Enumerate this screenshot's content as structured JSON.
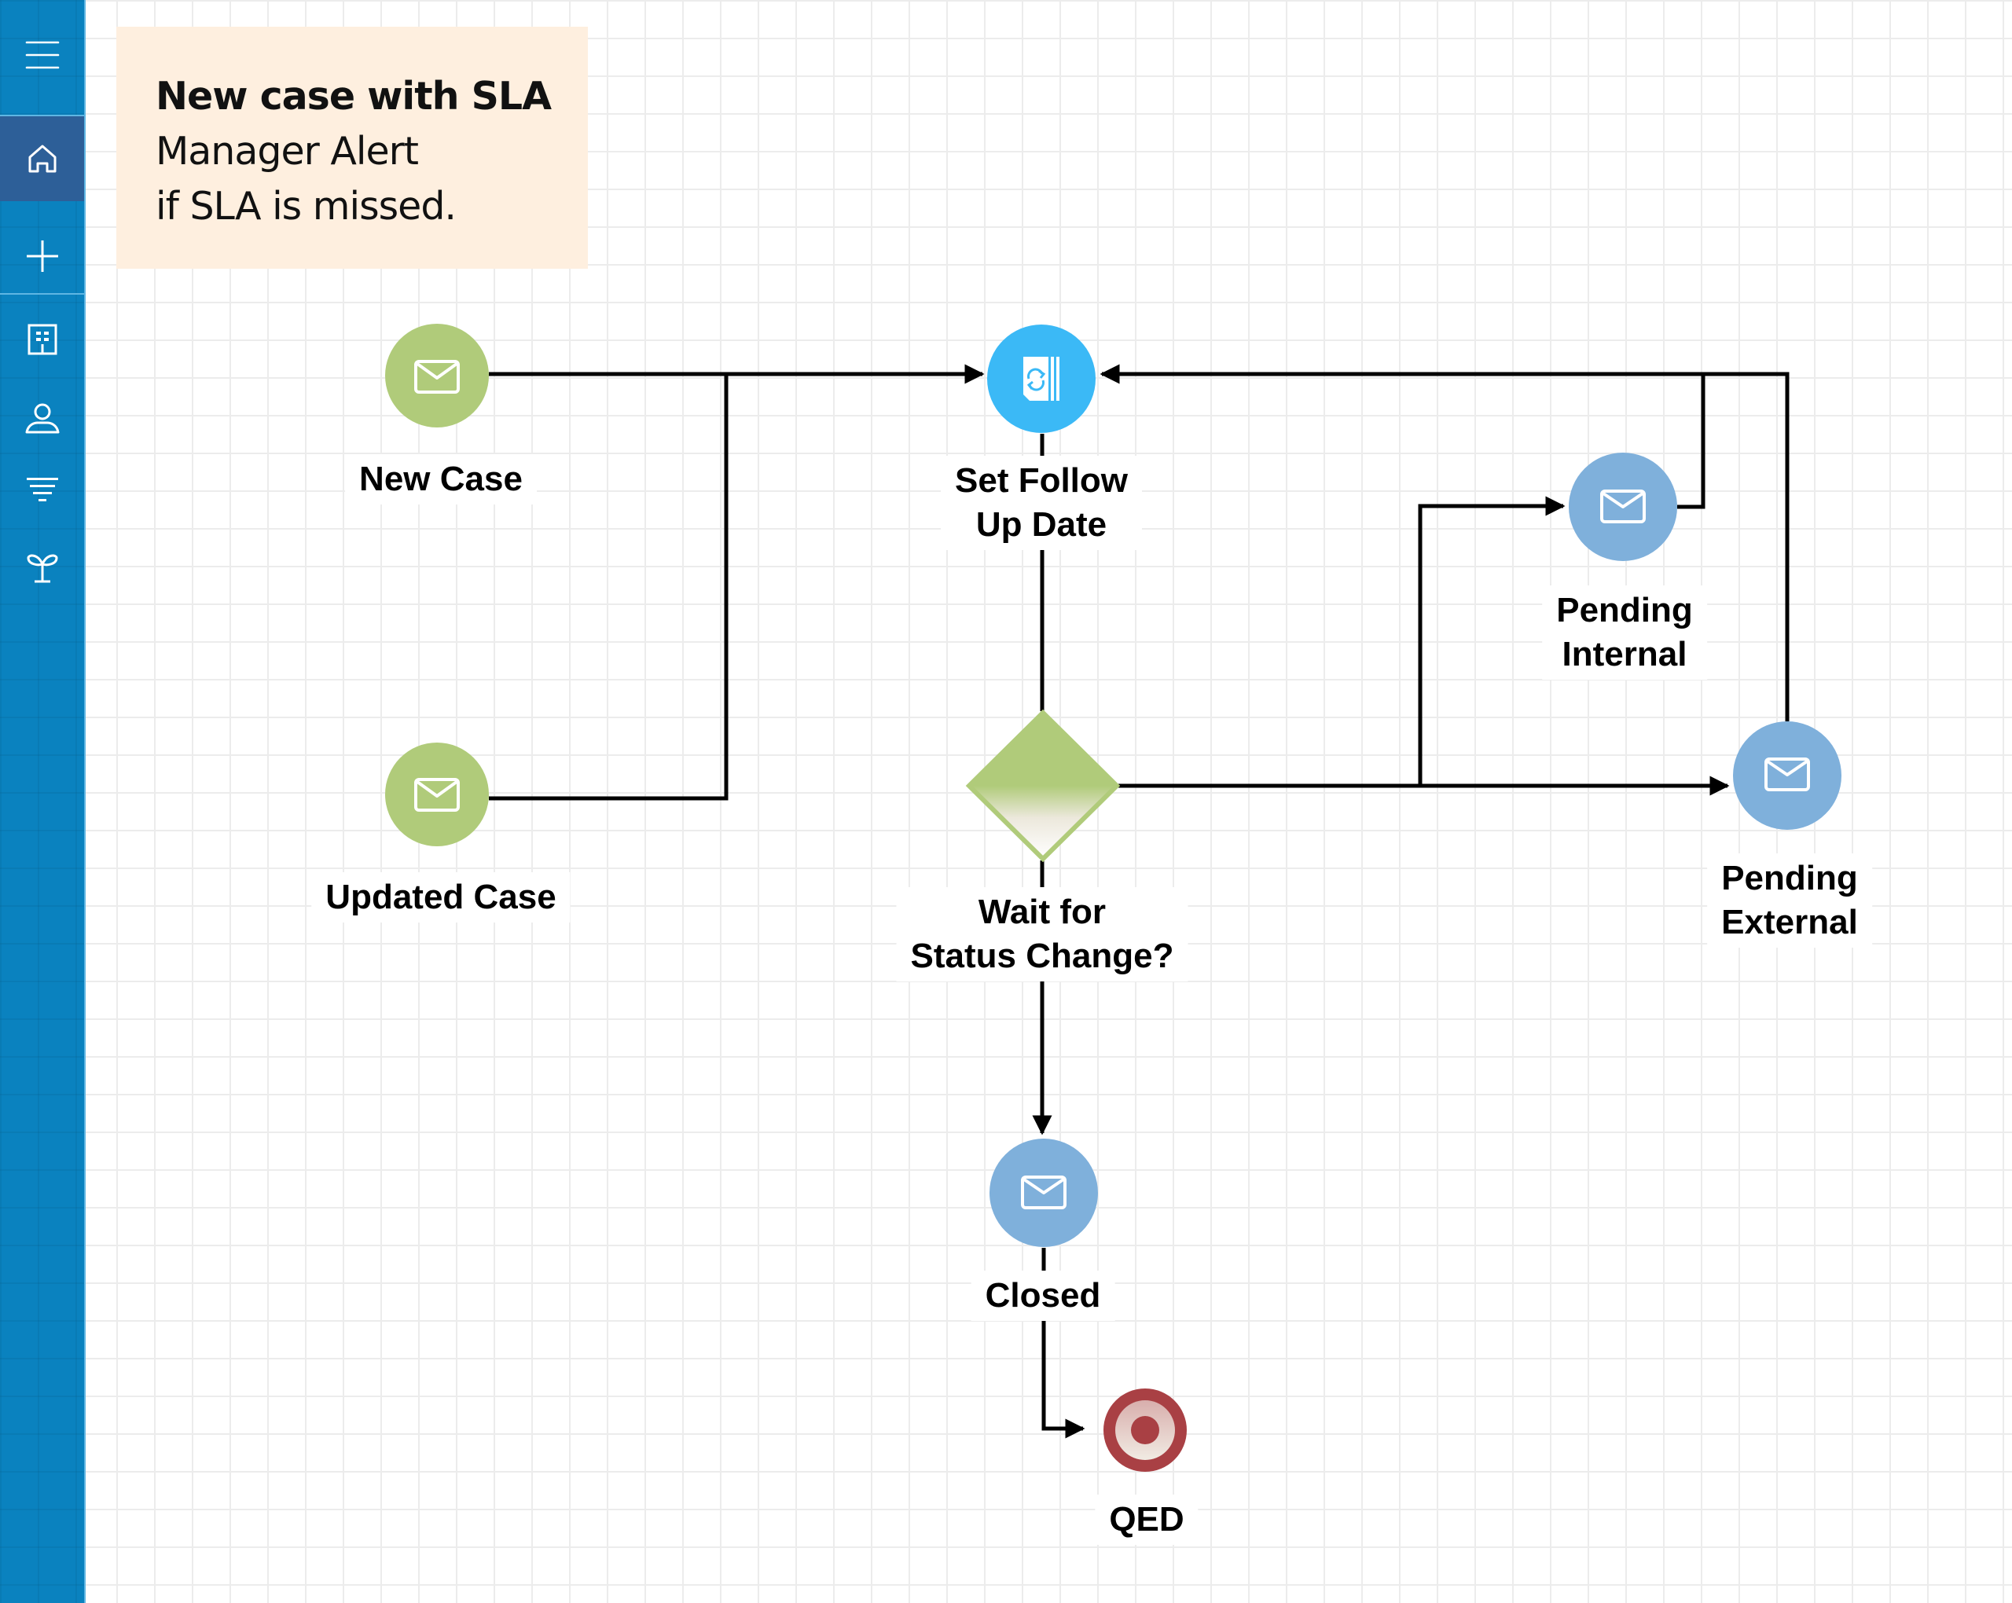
{
  "sidebar": {
    "items": [
      {
        "name": "menu",
        "icon": "hamburger-menu-icon",
        "active": false
      },
      {
        "name": "home",
        "icon": "home-icon",
        "active": true
      },
      {
        "name": "add",
        "icon": "plus-icon",
        "active": false
      },
      {
        "name": "accounts",
        "icon": "building-icon",
        "active": false
      },
      {
        "name": "contacts",
        "icon": "person-icon",
        "active": false
      },
      {
        "name": "filters",
        "icon": "funnel-icon",
        "active": false
      },
      {
        "name": "growth",
        "icon": "sprout-icon",
        "active": false
      }
    ],
    "color": "#0a82bf",
    "active_color": "#2d5f98"
  },
  "note": {
    "title": "New case with SLA",
    "line1": "Manager Alert",
    "line2": "if SLA is missed."
  },
  "diagram": {
    "nodes": [
      {
        "id": "new-case",
        "label": [
          "New Case"
        ],
        "type": "message-start",
        "icon": "envelope-icon",
        "color": "#b0cb7a"
      },
      {
        "id": "updated-case",
        "label": [
          "Updated Case"
        ],
        "type": "message-start",
        "icon": "envelope-icon",
        "color": "#b0cb7a"
      },
      {
        "id": "set-follow-up",
        "label": [
          "Set Follow",
          "Up Date"
        ],
        "type": "task",
        "icon": "refresh-document-icon",
        "color": "#3bb9f6"
      },
      {
        "id": "wait-status",
        "label": [
          "Wait for",
          "Status Change?"
        ],
        "type": "gateway",
        "color": "#b0cb7a"
      },
      {
        "id": "pending-internal",
        "label": [
          "Pending",
          "Internal"
        ],
        "type": "message",
        "icon": "envelope-icon",
        "color": "#7fb0db"
      },
      {
        "id": "pending-external",
        "label": [
          "Pending",
          "External"
        ],
        "type": "message",
        "icon": "envelope-icon",
        "color": "#7fb0db"
      },
      {
        "id": "closed",
        "label": [
          "Closed"
        ],
        "type": "message",
        "icon": "envelope-icon",
        "color": "#7fb0db"
      },
      {
        "id": "qed",
        "label": [
          "QED"
        ],
        "type": "end",
        "color": "#a94044"
      }
    ],
    "edges": [
      {
        "from": "new-case",
        "to": "set-follow-up"
      },
      {
        "from": "updated-case",
        "to": "set-follow-up"
      },
      {
        "from": "set-follow-up",
        "to": "wait-status"
      },
      {
        "from": "wait-status",
        "to": "pending-internal"
      },
      {
        "from": "wait-status",
        "to": "pending-external"
      },
      {
        "from": "wait-status",
        "to": "closed"
      },
      {
        "from": "pending-internal",
        "to": "set-follow-up"
      },
      {
        "from": "pending-external",
        "to": "set-follow-up"
      },
      {
        "from": "closed",
        "to": "qed"
      }
    ]
  }
}
